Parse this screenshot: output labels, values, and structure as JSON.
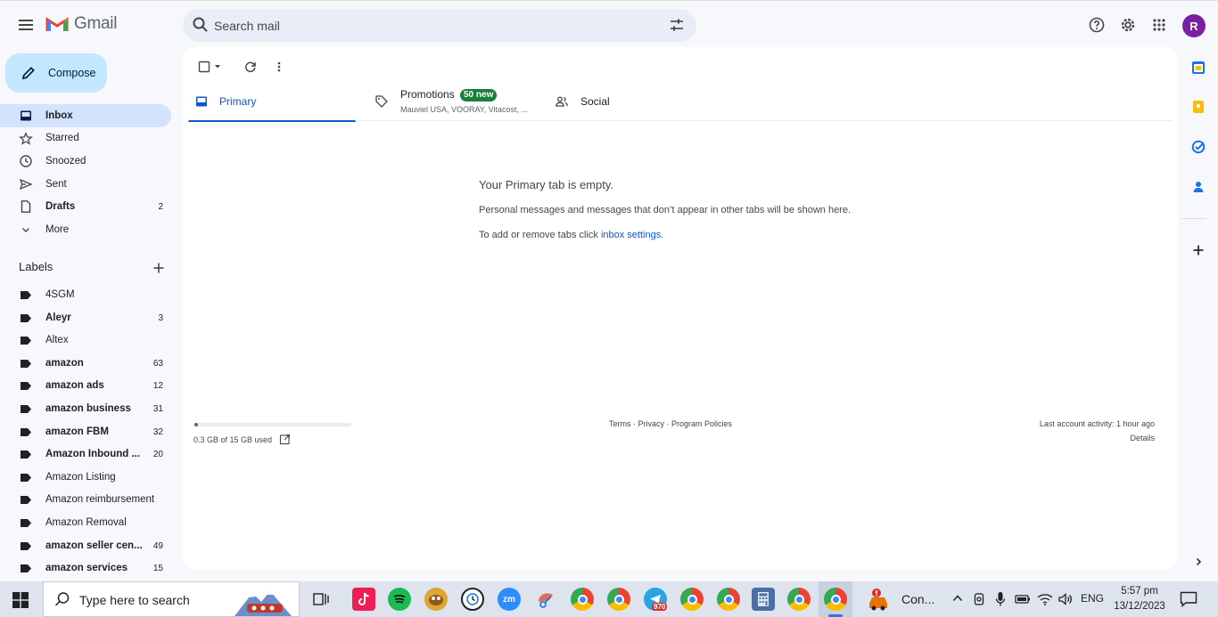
{
  "header": {
    "app_name": "Gmail",
    "search_placeholder": "Search mail",
    "avatar_letter": "R"
  },
  "sidebar": {
    "compose_label": "Compose",
    "nav": [
      {
        "label": "Inbox",
        "count": "",
        "bold": true,
        "active": true,
        "icon": "inbox-icon"
      },
      {
        "label": "Starred",
        "count": "",
        "bold": false,
        "active": false,
        "icon": "star-icon"
      },
      {
        "label": "Snoozed",
        "count": "",
        "bold": false,
        "active": false,
        "icon": "clock-icon"
      },
      {
        "label": "Sent",
        "count": "",
        "bold": false,
        "active": false,
        "icon": "send-icon"
      },
      {
        "label": "Drafts",
        "count": "2",
        "bold": true,
        "active": false,
        "icon": "draft-icon"
      },
      {
        "label": "More",
        "count": "",
        "bold": false,
        "active": false,
        "icon": "chevron-down-icon"
      }
    ],
    "labels_title": "Labels",
    "labels": [
      {
        "label": "4SGM",
        "count": "",
        "bold": false
      },
      {
        "label": "Aleyr",
        "count": "3",
        "bold": true
      },
      {
        "label": "Altex",
        "count": "",
        "bold": false
      },
      {
        "label": "amazon",
        "count": "63",
        "bold": true
      },
      {
        "label": "amazon ads",
        "count": "12",
        "bold": true
      },
      {
        "label": "amazon business",
        "count": "31",
        "bold": true
      },
      {
        "label": "amazon FBM",
        "count": "32",
        "bold": true
      },
      {
        "label": "Amazon Inbound ...",
        "count": "20",
        "bold": true
      },
      {
        "label": "Amazon Listing",
        "count": "",
        "bold": false
      },
      {
        "label": "Amazon reimbursement",
        "count": "",
        "bold": false
      },
      {
        "label": "Amazon Removal",
        "count": "",
        "bold": false
      },
      {
        "label": "amazon seller cen...",
        "count": "49",
        "bold": true
      },
      {
        "label": "amazon services",
        "count": "15",
        "bold": true
      }
    ]
  },
  "tabs": {
    "primary": "Primary",
    "promotions": "Promotions",
    "promotions_badge": "50 new",
    "promotions_senders": "Mauviel USA, VOORAY, Vitacost, ...",
    "social": "Social"
  },
  "empty_state": {
    "title": "Your Primary tab is empty.",
    "line1": "Personal messages and messages that don’t appear in other tabs will be shown here.",
    "line2_prefix": "To add or remove tabs click ",
    "line2_link": "inbox settings",
    "line2_suffix": "."
  },
  "footer": {
    "storage_used_fraction": 0.02,
    "storage_text": "0.3 GB of 15 GB used",
    "links": "Terms · Privacy · Program Policies",
    "last_activity": "Last account activity: 1 hour ago",
    "details": "Details"
  },
  "taskbar": {
    "search_placeholder": "Type here to search",
    "telegram_badge": "970",
    "zoom_label": "zm",
    "con_label": "Con...",
    "lang": "ENG",
    "time": "5:57 pm",
    "date": "13/12/2023"
  },
  "colors": {
    "accent": "#0b57d0",
    "compose_bg": "#c2e7ff",
    "active_nav": "#d3e3fd",
    "promo_badge": "#188038",
    "avatar": "#7b1fa2"
  }
}
